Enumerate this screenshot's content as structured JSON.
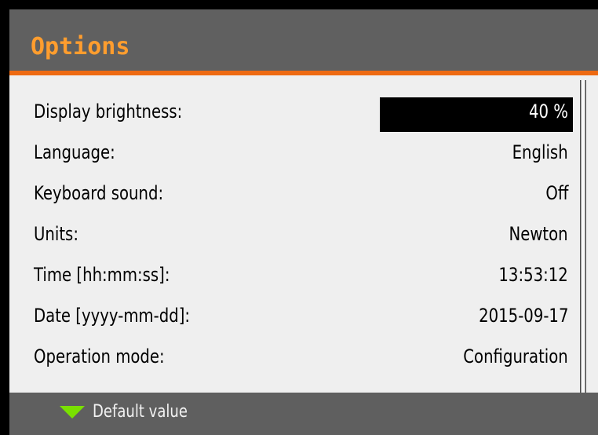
{
  "header": {
    "title": "Options"
  },
  "options": [
    {
      "label": "Display brightness:",
      "value": "40 %"
    },
    {
      "label": "Language:",
      "value": "English"
    },
    {
      "label": "Keyboard sound:",
      "value": "Off"
    },
    {
      "label": "Units:",
      "value": "Newton"
    },
    {
      "label": "Time [hh:mm:ss]:",
      "value": "13:53:12"
    },
    {
      "label": "Date [yyyy-mm-dd]:",
      "value": "2015-09-17"
    },
    {
      "label": "Operation mode:",
      "value": "Configuration"
    }
  ],
  "footer": {
    "icon": "down-triangle-icon",
    "label": "Default value"
  },
  "colors": {
    "title": "#ff9d2e",
    "accent_line": "#ee6a12",
    "footer_icon": "#79e000"
  }
}
